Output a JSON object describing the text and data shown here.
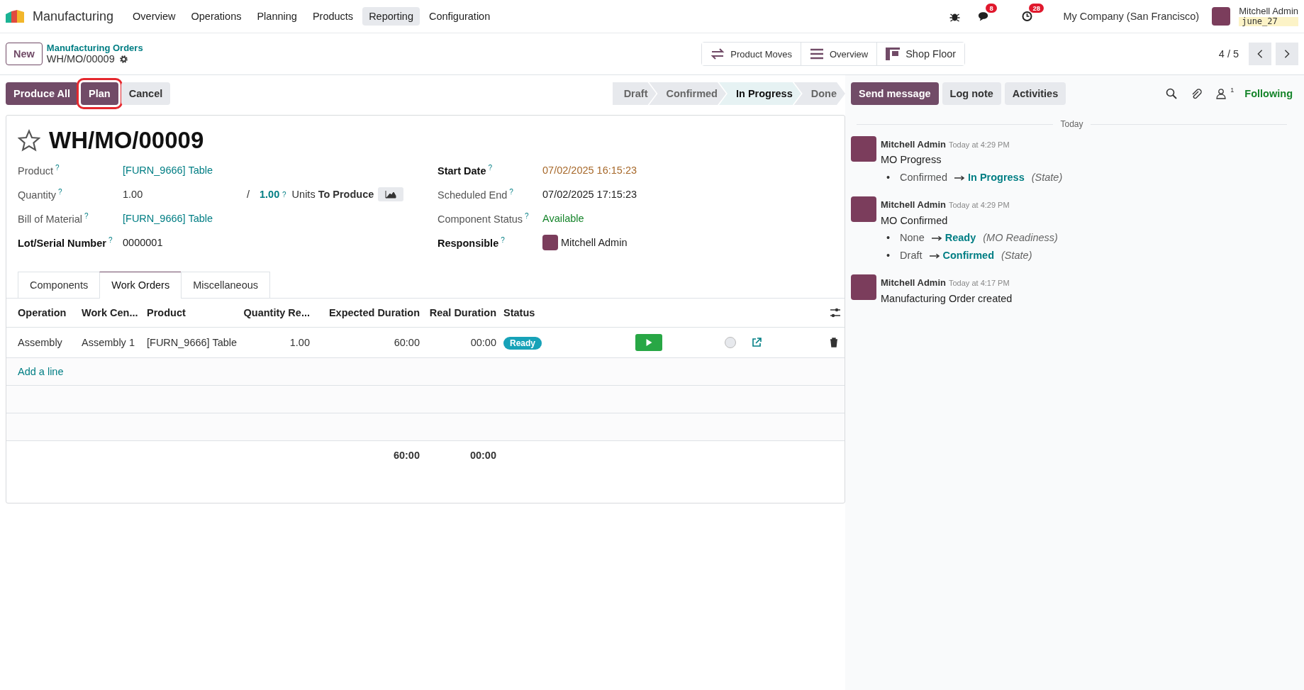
{
  "navbar": {
    "app_name": "Manufacturing",
    "menu": [
      {
        "label": "Overview",
        "selected": false
      },
      {
        "label": "Operations",
        "selected": false
      },
      {
        "label": "Planning",
        "selected": false
      },
      {
        "label": "Products",
        "selected": false
      },
      {
        "label": "Reporting",
        "selected": true
      },
      {
        "label": "Configuration",
        "selected": false
      }
    ],
    "messages_badge": "8",
    "activities_badge": "28",
    "company": "My Company (San Francisco)",
    "user": {
      "name": "Mitchell Admin",
      "database": "june_27"
    }
  },
  "control_panel": {
    "new_button": "New",
    "breadcrumb": {
      "parent": "Manufacturing Orders",
      "current": "WH/MO/00009"
    },
    "view_buttons": [
      {
        "label": "Product Moves",
        "kind": "moves"
      },
      {
        "label": "Overview",
        "kind": "list"
      },
      {
        "label": "Shop Floor",
        "kind": "floor"
      }
    ],
    "pager": "4 / 5"
  },
  "actions": [
    {
      "label": "Produce All",
      "kind": "primary",
      "highlighted": false
    },
    {
      "label": "Plan",
      "kind": "primary",
      "highlighted": true
    },
    {
      "label": "Cancel",
      "kind": "secondary",
      "highlighted": false
    }
  ],
  "statusbar": [
    {
      "label": "Draft",
      "selected": false
    },
    {
      "label": "Confirmed",
      "selected": false
    },
    {
      "label": "In Progress",
      "selected": true
    },
    {
      "label": "Done",
      "selected": false
    }
  ],
  "form": {
    "title": "WH/MO/00009",
    "starred": false,
    "left_fields": [
      {
        "label": "Product",
        "help": "?",
        "kind": "link",
        "required": false,
        "value": "[FURN_9666] Table"
      },
      {
        "label": "Quantity",
        "help": "?",
        "kind": "quantity",
        "required": false,
        "value": "1.00",
        "separator": "/",
        "target": "1.00",
        "target_help": "?",
        "uom": "Units",
        "suffix": "To Produce"
      },
      {
        "label": "Bill of Material",
        "help": "?",
        "kind": "link",
        "required": false,
        "value": "[FURN_9666] Table"
      },
      {
        "label": "Lot/Serial Number",
        "help": "?",
        "kind": "text",
        "required": true,
        "value": "0000001"
      }
    ],
    "right_fields": [
      {
        "label": "Start Date",
        "help": "?",
        "kind": "warning",
        "required": true,
        "value": "07/02/2025 16:15:23"
      },
      {
        "label": "Scheduled End",
        "help": "?",
        "kind": "text",
        "required": false,
        "value": "07/02/2025 17:15:23"
      },
      {
        "label": "Component Status",
        "help": "?",
        "kind": "success",
        "required": false,
        "value": "Available"
      },
      {
        "label": "Responsible",
        "help": "?",
        "kind": "user",
        "required": true,
        "value": "Mitchell Admin"
      }
    ]
  },
  "tabs": [
    {
      "label": "Components",
      "selected": false
    },
    {
      "label": "Work Orders",
      "selected": true
    },
    {
      "label": "Miscellaneous",
      "selected": false
    }
  ],
  "table": {
    "columns": [
      "Operation",
      "Work Cen...",
      "Product",
      "Quantity Re...",
      "Expected Duration",
      "Real Duration",
      "Status"
    ],
    "rows": [
      {
        "operation": "Assembly",
        "work_center": "Assembly 1",
        "product": "[FURN_9666] Table",
        "quantity": "1.00",
        "expected": "60:00",
        "real": "00:00",
        "status": "Ready",
        "done": false
      }
    ],
    "add_line": "Add a line",
    "totals": {
      "expected": "60:00",
      "real": "00:00"
    }
  },
  "chatter": {
    "buttons": [
      {
        "label": "Send message",
        "kind": "primary"
      },
      {
        "label": "Log note",
        "kind": "secondary"
      },
      {
        "label": "Activities",
        "kind": "secondary"
      }
    ],
    "followers": "1",
    "follow_label": "Following",
    "date": "Today",
    "messages": [
      {
        "author": "Mitchell Admin",
        "time": "Today at 4:29 PM",
        "body": "MO Progress",
        "changes": [
          {
            "bullet": "•",
            "old": "Confirmed",
            "new": "In Progress",
            "field": "(State)"
          }
        ]
      },
      {
        "author": "Mitchell Admin",
        "time": "Today at 4:29 PM",
        "body": "MO Confirmed",
        "changes": [
          {
            "bullet": "•",
            "old": "None",
            "new": "Ready",
            "field": "(MO Readiness)"
          },
          {
            "bullet": "•",
            "old": "Draft",
            "new": "Confirmed",
            "field": "(State)"
          }
        ]
      },
      {
        "author": "Mitchell Admin",
        "time": "Today at 4:17 PM",
        "body": "Manufacturing Order created"
      }
    ]
  }
}
